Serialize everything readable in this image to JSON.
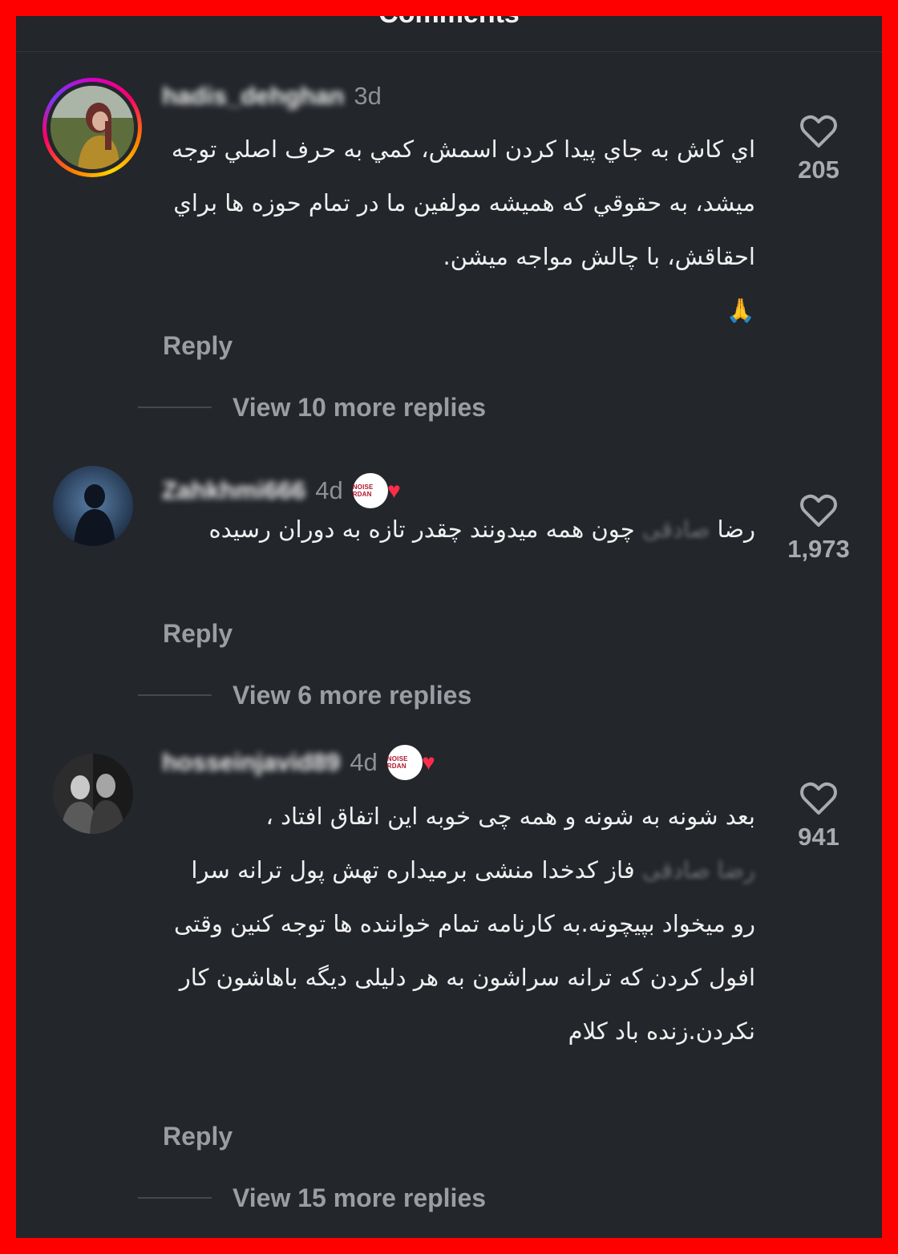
{
  "sheet": {
    "title": "Comments"
  },
  "comments": [
    {
      "username": "hadis_dehghan",
      "time": "3d",
      "text": "اي كاش به جاي پيدا كردن اسمش، كمي به حرف اصلي توجه ميشد، به حقوقي كه هميشه مولفين ما در تمام حوزه ها براي احقاقش، با چالش مواجه ميشن.\n🙏",
      "reply_label": "Reply",
      "view_replies": "View 10 more replies",
      "likes": "205"
    },
    {
      "username": "Zahkhmi666",
      "time": "4d",
      "text_before": "رضا ",
      "text_redacted": "صادقی",
      "text_after": " چون همه میدونند چقدر تازه به دوران رسیده",
      "reply_label": "Reply",
      "view_replies": "View 6 more replies",
      "likes": "1,973",
      "badge_text": "NOISE RDAN"
    },
    {
      "username": "hosseinjavid89",
      "time": "4d",
      "text_before": "بعد شونه به شونه و همه چی خوبه این اتفاق افتاد ،",
      "text_redacted": "رضا صادقی",
      "text_after": " فاز کدخدا منشی برمیداره تهش پول ترانه سرا رو میخواد بپیچونه.به کارنامه تمام خواننده ها توجه کنین وقتی افول کردن که ترانه سراشون به هر دلیلی دیگه باهاشون کار نکردن.زنده باد کلام",
      "reply_label": "Reply",
      "view_replies": "View 15 more replies",
      "likes": "941",
      "badge_text": "NOISE RDAN"
    }
  ],
  "colors": {
    "background": "#23262b",
    "border": "#ff0000",
    "text": "#f0f0f0",
    "muted": "#9b9da2",
    "badge_heart": "#ff2d4a"
  },
  "icons": [
    "heart-outline-icon",
    "verified-heart-badge"
  ]
}
